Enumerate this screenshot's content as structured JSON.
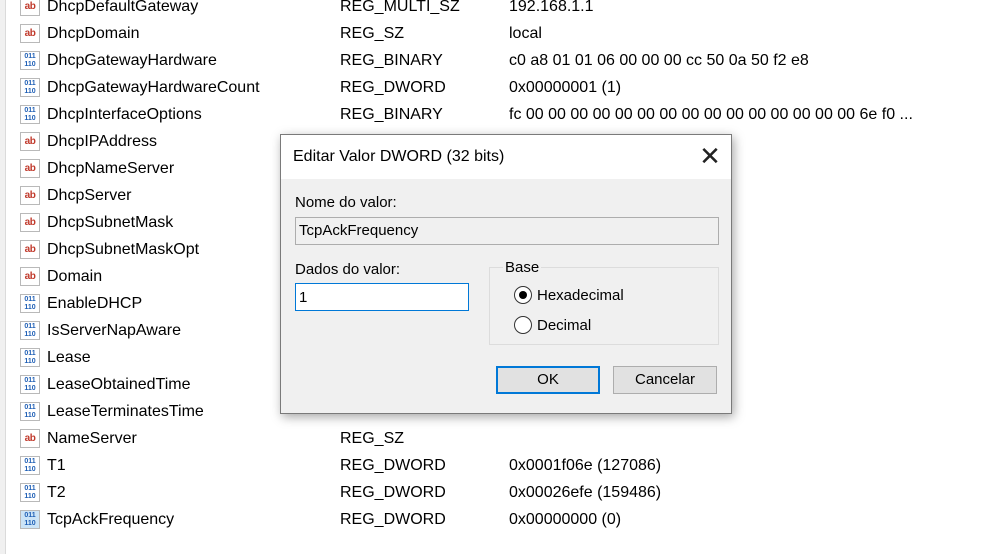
{
  "registry": {
    "rows": [
      {
        "name": "DhcpDefaultGateway",
        "type": "REG_MULTI_SZ",
        "data": "192.168.1.1",
        "icon": "string-value-icon"
      },
      {
        "name": "DhcpDomain",
        "type": "REG_SZ",
        "data": "local",
        "icon": "string-value-icon"
      },
      {
        "name": "DhcpGatewayHardware",
        "type": "REG_BINARY",
        "data": "c0 a8 01 01 06 00 00 00 cc 50 0a 50 f2 e8",
        "icon": "binary-value-icon"
      },
      {
        "name": "DhcpGatewayHardwareCount",
        "type": "REG_DWORD",
        "data": "0x00000001 (1)",
        "icon": "binary-value-icon"
      },
      {
        "name": "DhcpInterfaceOptions",
        "type": "REG_BINARY",
        "data": "fc 00 00 00 00 00 00 00 00 00 00 00 00 00 00 00 6e f0 ...",
        "icon": "binary-value-icon"
      },
      {
        "name": "DhcpIPAddress",
        "type": "",
        "data": "",
        "icon": "string-value-icon"
      },
      {
        "name": "DhcpNameServer",
        "type": "",
        "data": "",
        "icon": "string-value-icon"
      },
      {
        "name": "DhcpServer",
        "type": "",
        "data": "",
        "icon": "string-value-icon"
      },
      {
        "name": "DhcpSubnetMask",
        "type": "",
        "data": "",
        "icon": "string-value-icon"
      },
      {
        "name": "DhcpSubnetMaskOpt",
        "type": "",
        "data": "",
        "icon": "string-value-icon"
      },
      {
        "name": "Domain",
        "type": "",
        "data": "",
        "icon": "string-value-icon"
      },
      {
        "name": "EnableDHCP",
        "type": "",
        "data": "",
        "icon": "binary-value-icon"
      },
      {
        "name": "IsServerNapAware",
        "type": "",
        "data": "",
        "icon": "binary-value-icon"
      },
      {
        "name": "Lease",
        "type": "",
        "data": "",
        "icon": "binary-value-icon"
      },
      {
        "name": "LeaseObtainedTime",
        "type": "",
        "data": "",
        "icon": "binary-value-icon"
      },
      {
        "name": "LeaseTerminatesTime",
        "type": "",
        "data": "",
        "icon": "binary-value-icon"
      },
      {
        "name": "NameServer",
        "type": "REG_SZ",
        "data": "",
        "icon": "string-value-icon"
      },
      {
        "name": "T1",
        "type": "REG_DWORD",
        "data": "0x0001f06e (127086)",
        "icon": "binary-value-icon"
      },
      {
        "name": "T2",
        "type": "REG_DWORD",
        "data": "0x00026efe (159486)",
        "icon": "binary-value-icon"
      },
      {
        "name": "TcpAckFrequency",
        "type": "REG_DWORD",
        "data": "0x00000000 (0)",
        "icon": "binary-value-icon",
        "selected": true
      }
    ]
  },
  "dialog": {
    "title": "Editar Valor DWORD (32 bits)",
    "close_icon": "close-icon",
    "value_name_label": "Nome do valor:",
    "value_name": "TcpAckFrequency",
    "value_data_label": "Dados do valor:",
    "value_data": "1",
    "base_label": "Base",
    "hex_label": "Hexadecimal",
    "dec_label": "Decimal",
    "base_selected": "Hexadecimal",
    "ok_label": "OK",
    "cancel_label": "Cancelar"
  },
  "colors": {
    "accent": "#0078d7",
    "dialog_bg": "#f0f0f0",
    "string_icon": "#c0392b",
    "binary_icon": "#1f5fb5"
  }
}
